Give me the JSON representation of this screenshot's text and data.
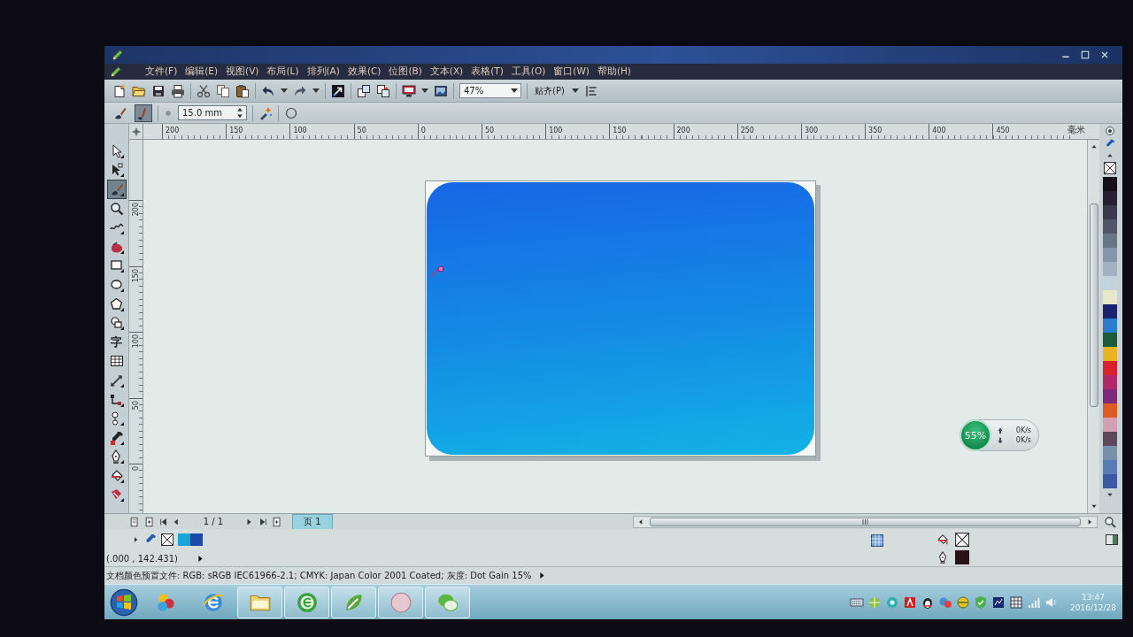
{
  "menu": [
    "文件(F)",
    "编辑(E)",
    "视图(V)",
    "布局(L)",
    "排列(A)",
    "效果(C)",
    "位图(B)",
    "文本(X)",
    "表格(T)",
    "工具(O)",
    "窗口(W)",
    "帮助(H)"
  ],
  "toolbar": {
    "zoom": "47%",
    "snap": "贴齐(P)"
  },
  "property_bar": {
    "tools": [
      {
        "selected": false
      },
      {
        "selected": true
      }
    ],
    "nib_size": "15.0 mm"
  },
  "toolbox": [
    {
      "selected": false
    },
    {
      "selected": false
    },
    {
      "selected": true
    },
    {
      "selected": false
    },
    {
      "selected": false
    },
    {
      "selected": false
    },
    {
      "selected": false
    },
    {
      "selected": false
    },
    {
      "selected": false
    },
    {
      "selected": false
    },
    {
      "selected": false,
      "label": "字"
    },
    {
      "selected": false
    },
    {
      "selected": false
    },
    {
      "selected": false
    },
    {
      "selected": false
    },
    {
      "selected": false
    },
    {
      "selected": false
    },
    {
      "selected": false
    },
    {
      "selected": false
    }
  ],
  "horizontal_ruler": {
    "labels": [
      "200",
      "150",
      "100",
      "50",
      "0",
      "50",
      "100",
      "150",
      "200",
      "250",
      "300",
      "350",
      "400",
      "450"
    ],
    "unit": "毫米"
  },
  "vertical_ruler": {
    "labels": [
      "200",
      "150",
      "100",
      "50",
      "0"
    ]
  },
  "network_monitor": {
    "usage": "55%",
    "upload": "0K/s",
    "download": "0K/s"
  },
  "color_palette": [
    {
      "color": "#140e16"
    },
    {
      "color": "#262030"
    },
    {
      "color": "#3a3a4a"
    },
    {
      "color": "#4e5668"
    },
    {
      "color": "#687688"
    },
    {
      "color": "#8496a8"
    },
    {
      "color": "#a2b2c2"
    },
    {
      "color": "#c4d2dc"
    },
    {
      "color": "#e6e8c8"
    },
    {
      "color": "#1c2272"
    },
    {
      "color": "#2a7ccc"
    },
    {
      "color": "#1a5c3c"
    },
    {
      "color": "#e8b422"
    },
    {
      "color": "#d8222e"
    },
    {
      "color": "#b0286a"
    },
    {
      "color": "#7e2a7a"
    },
    {
      "color": "#e05a22"
    },
    {
      "color": "#d2a0b2"
    },
    {
      "color": "#5e4a5a"
    },
    {
      "color": "#7890aa"
    },
    {
      "color": "#5a7cb4"
    },
    {
      "color": "#3c58a4"
    }
  ],
  "page_navigator": {
    "position": "1 / 1",
    "tabs": [
      {
        "label": "页 1",
        "selected": true
      }
    ]
  },
  "document_palette": [
    {
      "color": "#19a3d6"
    },
    {
      "color": "#1d4aa6"
    }
  ],
  "fill_outline": {
    "fill": {
      "kind": "none"
    },
    "outline": {
      "kind": "solid",
      "color": "#2a1218"
    }
  },
  "status_bar": {
    "coordinates": "(.000 , 142.431)",
    "color_profile": "文档颜色预置文件: RGB: sRGB IEC61966-2.1; CMYK: Japan Color 2001 Coated; 灰度: Dot Gain 15%"
  },
  "taskbar": {
    "time": "13:47",
    "date": "2016/12/28"
  }
}
